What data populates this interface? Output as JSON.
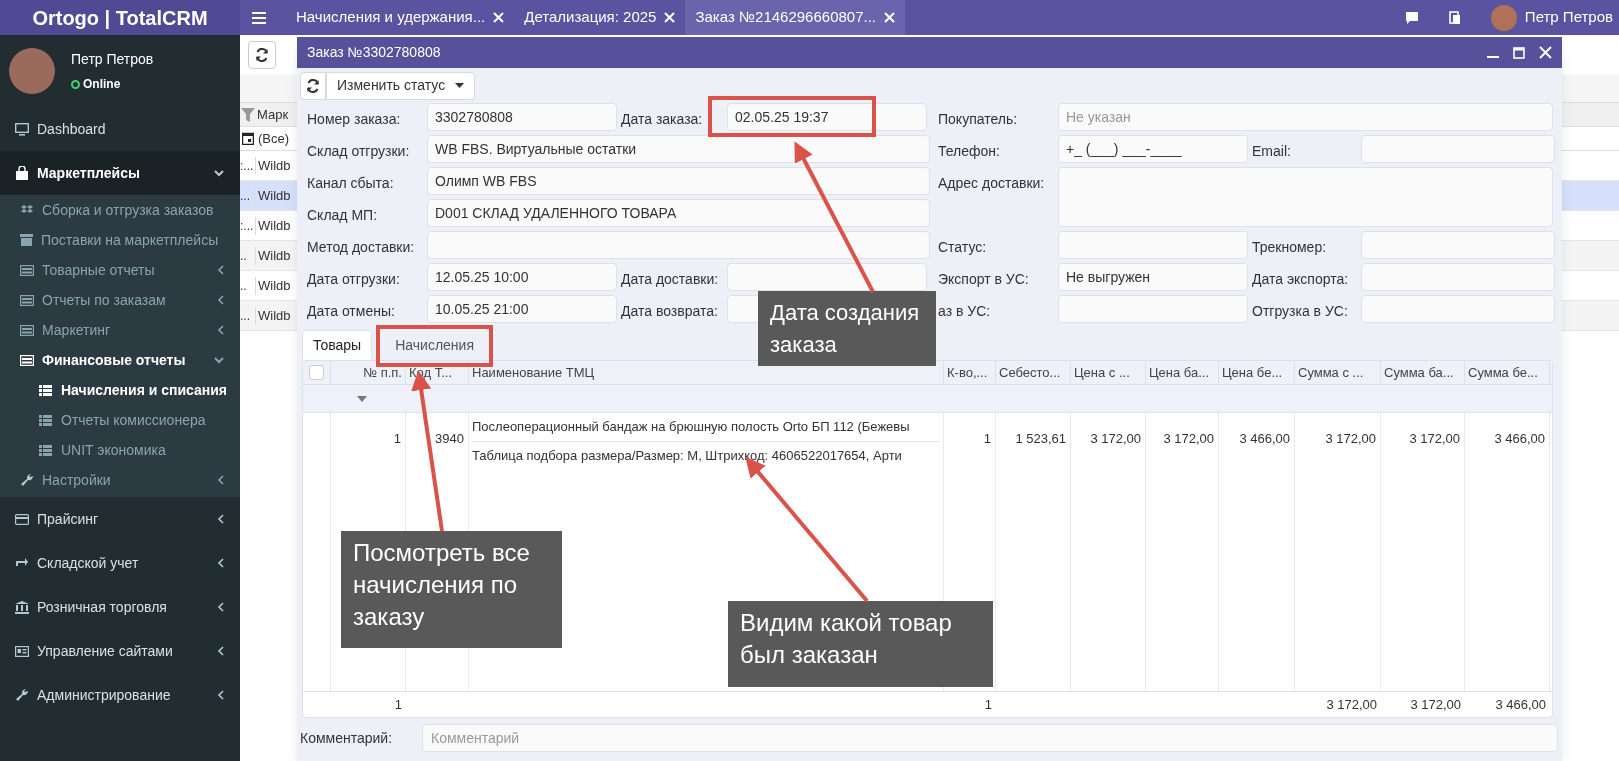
{
  "app": {
    "logo": "Ortogo | TotalCRM"
  },
  "top_tabs": [
    {
      "label": "Начисления и удержания...",
      "selected": false
    },
    {
      "label": "Детализация: 2025",
      "selected": false
    },
    {
      "label": "Заказ №2146296660807...",
      "selected": true
    }
  ],
  "top_user": {
    "name": "Петр Петров"
  },
  "user": {
    "name": "Петр Петров",
    "status": "Online"
  },
  "sidebar": {
    "items": [
      {
        "label": "Dashboard",
        "selected": false
      },
      {
        "label": "Маркетплейсы",
        "expanded": true,
        "children": [
          {
            "label": "Сборка и отгрузка заказов",
            "selected": false
          },
          {
            "label": "Поставки на маркетплейсы",
            "selected": false
          },
          {
            "label": "Товарные отчеты",
            "expanded": false
          },
          {
            "label": "Отчеты по заказам",
            "expanded": false
          },
          {
            "label": "Маркетинг",
            "expanded": false
          },
          {
            "label": "Финансовые отчеты",
            "expanded": true,
            "children": [
              {
                "label": "Начисления и списания",
                "selected": true
              },
              {
                "label": "Отчеты комиссионера",
                "selected": false
              },
              {
                "label": "UNIT экономика",
                "selected": false
              }
            ]
          },
          {
            "label": "Настройки",
            "expanded": false
          }
        ]
      },
      {
        "label": "Прайсинг",
        "expanded": false
      },
      {
        "label": "Складской учет",
        "expanded": false
      },
      {
        "label": "Розничная торговля",
        "expanded": false
      },
      {
        "label": "Управление сайтами",
        "expanded": false
      },
      {
        "label": "Администрирование",
        "expanded": false
      }
    ]
  },
  "background_grid": {
    "header": "Марк",
    "filter_value": "(Все)",
    "rows": [
      {
        "col_1": ":...",
        "col_2": "Wildb",
        "selected": false
      },
      {
        "col_1": "...",
        "col_2": "Wildb",
        "selected": true
      },
      {
        "col_1": ":...",
        "col_2": "Wildb",
        "selected": false
      },
      {
        "col_1": "..",
        "col_2": "Wildb",
        "selected": false
      },
      {
        "col_1": "..",
        "col_2": "Wildb",
        "selected": false
      },
      {
        "col_1": "...",
        "col_2": "Wildb",
        "selected": false
      }
    ]
  },
  "order_window": {
    "title": "Заказ №3302780808",
    "status_button": "Изменить статус",
    "left_rows": [
      {
        "kind": "pair",
        "fields": [
          {
            "label": "Номер заказа:",
            "value": "3302780808"
          },
          {
            "label": "Дата заказа:",
            "value": "02.05.25 19:37"
          }
        ]
      },
      {
        "kind": "wide",
        "fields": [
          {
            "label": "Склад отгрузки:",
            "value": "WB FBS. Виртуальные остатки"
          }
        ]
      },
      {
        "kind": "wide",
        "fields": [
          {
            "label": "Канал сбыта:",
            "value": "Олимп WB FBS"
          }
        ]
      },
      {
        "kind": "wide",
        "fields": [
          {
            "label": "Склад МП:",
            "value": "D001 СКЛАД УДАЛЕННОГО ТОВАРА"
          }
        ]
      },
      {
        "kind": "wide",
        "fields": [
          {
            "label": "Метод доставки:"
          }
        ]
      },
      {
        "kind": "pair",
        "fields": [
          {
            "label": "Дата отгрузки:",
            "value": "12.05.25 10:00"
          },
          {
            "label": "Дата доставки:"
          }
        ]
      },
      {
        "kind": "pair",
        "fields": [
          {
            "label": "Дата отмены:",
            "value": "10.05.25 21:00"
          },
          {
            "label": "Дата возврата:"
          }
        ]
      }
    ],
    "right_rows": [
      {
        "kind": "wide",
        "fields": [
          {
            "label": "Покупатель:",
            "placeholder": "Не указан"
          }
        ]
      },
      {
        "kind": "pair",
        "fields": [
          {
            "label": "Телефон:",
            "value": "+_ (___) ___-____"
          },
          {
            "label": "Email:"
          }
        ]
      },
      {
        "kind": "textarea",
        "fields": [
          {
            "label": "Адрес доставки:"
          }
        ]
      },
      {
        "kind": "pair",
        "fields": [
          {
            "label": "Статус:"
          },
          {
            "label": "Трекномер:"
          }
        ]
      },
      {
        "kind": "pair",
        "fields": [
          {
            "label": "Экспорт в УС:",
            "value": "Не выгружен"
          },
          {
            "label": "Дата экспорта:"
          }
        ]
      },
      {
        "kind": "pair",
        "fields": [
          {
            "label": "аз в УС:"
          },
          {
            "label": "Отгрузка в УС:"
          }
        ]
      }
    ],
    "tabs": [
      {
        "label": "Товары",
        "selected": true
      },
      {
        "label": "Начисления",
        "selected": false
      }
    ],
    "table": {
      "select_all": {
        "checked": false
      },
      "columns": [
        "№ п.п.",
        "Код Т...",
        "Наименование ТМЦ",
        "К-во,...",
        "Себесто...",
        "Цена с ...",
        "Цена ба...",
        "Цена бе...",
        "Сумма с ...",
        "Сумма ба...",
        "Сумма бе..."
      ],
      "rows": [
        {
          "number": "1",
          "code": "3940",
          "name": "Послеоперационный бандаж на брюшную полость Orto БП 112 (Бежевы",
          "details": "Таблица подбора размера/Размер: М, Штрихкод: 4606522017654, Арти",
          "values": [
            "1",
            "1 523,61",
            "3 172,00",
            "3 172,00",
            "3 466,00",
            "3 172,00",
            "3 172,00",
            "3 466,00"
          ]
        }
      ],
      "footer": {
        "number": "1",
        "quantity": "1",
        "sums": [
          "3 172,00",
          "3 172,00",
          "3 466,00"
        ]
      }
    },
    "comment": {
      "label": "Комментарий:",
      "placeholder": "Комментарий"
    }
  },
  "annotations": [
    {
      "kind": "callout",
      "text": "Дата создания заказа"
    },
    {
      "kind": "callout",
      "text": "Посмотреть все начисления по заказу"
    },
    {
      "kind": "callout",
      "text": "Видим какой товар был заказан"
    }
  ]
}
